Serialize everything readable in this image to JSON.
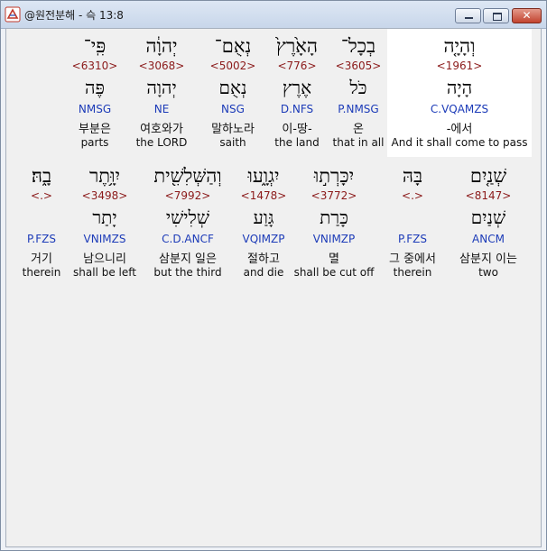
{
  "window": {
    "title": "@원전분해 - 슥 13:8"
  },
  "rows": [
    [
      {
        "hebrew": "פִּֽי־",
        "strongs": "<6310>",
        "lemma": "פֶּה",
        "parse": "NMSG",
        "korean": "부분은",
        "english": "parts",
        "selected": false
      },
      {
        "hebrew": "יְהוָ֔ה",
        "strongs": "<3068>",
        "lemma": "יְהוָה",
        "parse": "NE",
        "korean": "여호와가",
        "english": "the LORD",
        "selected": false
      },
      {
        "hebrew": "נְאֻם־",
        "strongs": "<5002>",
        "lemma": "נְאֻם",
        "parse": "NSG",
        "korean": "말하노라",
        "english": "saith",
        "selected": false
      },
      {
        "hebrew": "הָאָ֙רֶץ֙",
        "strongs": "<776>",
        "lemma": "אֶרֶץ",
        "parse": "D.NFS",
        "korean": "이-땅-",
        "english": "the land",
        "selected": false
      },
      {
        "hebrew": "בְכָל־",
        "strongs": "<3605>",
        "lemma": "כֹּל",
        "parse": "P.NMSG",
        "korean": "온",
        "english": "that in all",
        "selected": false
      },
      {
        "hebrew": "וְהָיָ֤ה",
        "strongs": "<1961>",
        "lemma": "הָיָה",
        "parse": "C.VQAMZS",
        "korean": "-에서",
        "english": "And it shall come to pass",
        "selected": true
      }
    ],
    [
      {
        "hebrew": "בָ֑הּ׃",
        "strongs": "<.>",
        "lemma": "",
        "parse": "P.FZS",
        "korean": "거기",
        "english": "therein",
        "selected": false
      },
      {
        "hebrew": "יִוָּ֥תֶר",
        "strongs": "<3498>",
        "lemma": "יָתַר",
        "parse": "VNIMZS",
        "korean": "남으니리",
        "english": "shall be left",
        "selected": false
      },
      {
        "hebrew": "וְהַשְּׁלִשִׁ֖ית",
        "strongs": "<7992>",
        "lemma": "שְׁלִישִׁי",
        "parse": "C.D.ANCF",
        "korean": "삼분지 일은",
        "english": "but the third",
        "selected": false
      },
      {
        "hebrew": "יִגְוָ֑עוּ",
        "strongs": "<1478>",
        "lemma": "גָּוַע",
        "parse": "VQIMZP",
        "korean": "절하고",
        "english": "and die",
        "selected": false
      },
      {
        "hebrew": "יִכָּרְת֣וּ",
        "strongs": "<3772>",
        "lemma": "כָּרַת",
        "parse": "VNIMZP",
        "korean": "멸",
        "english": "shall be cut off",
        "selected": false
      },
      {
        "hebrew": "בָּהּ",
        "strongs": "<.>",
        "lemma": "",
        "parse": "P.FZS",
        "korean": "그 중에서",
        "english": "therein",
        "selected": false
      },
      {
        "hebrew": "שְׁנַ֤יִם",
        "strongs": "<8147>",
        "lemma": "שְׁנַיִם",
        "parse": "ANCM",
        "korean": "삼분지 이는",
        "english": "two",
        "selected": false
      }
    ]
  ]
}
